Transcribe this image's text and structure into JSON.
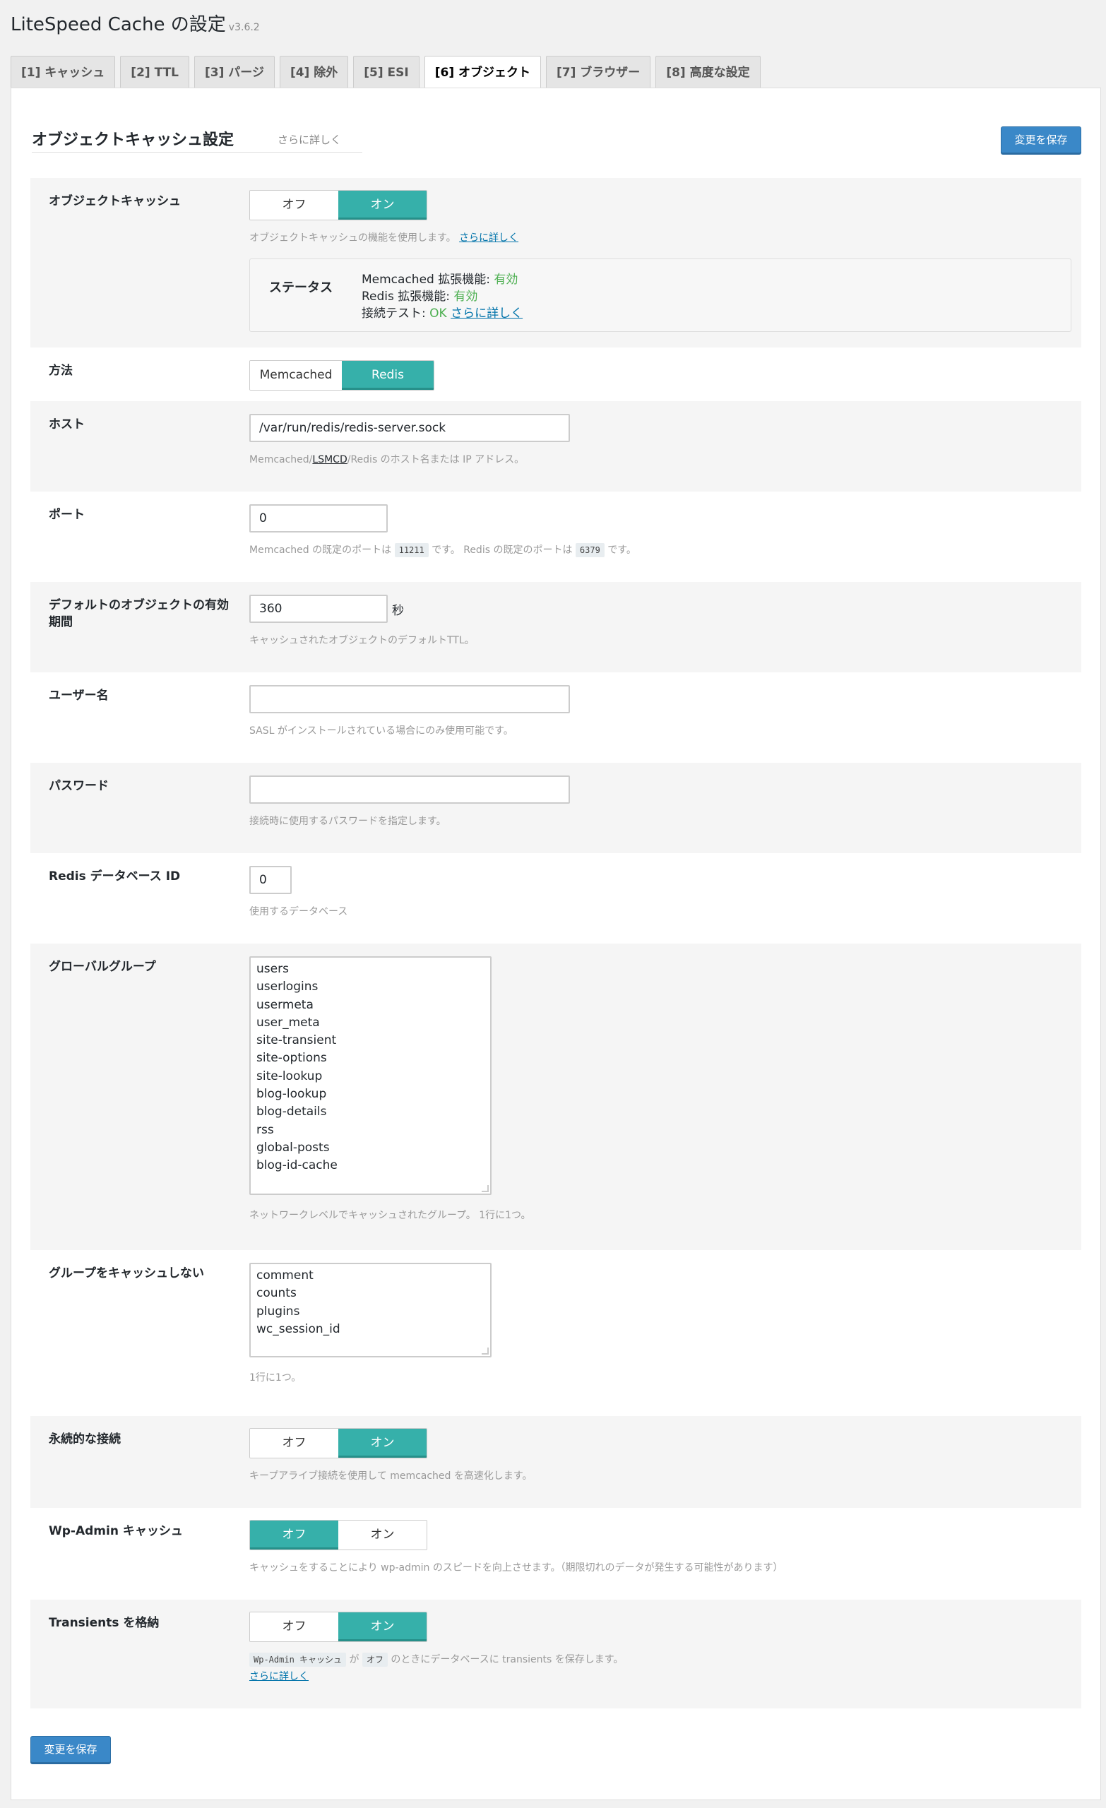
{
  "header": {
    "title": "LiteSpeed Cache の設定",
    "version": "v3.6.2"
  },
  "tabs": [
    "[1] キャッシュ",
    "[2] TTL",
    "[3] パージ",
    "[4] 除外",
    "[5] ESI",
    "[6] オブジェクト",
    "[7] ブラウザー",
    "[8] 高度な設定"
  ],
  "section": {
    "title": "オブジェクトキャッシュ設定",
    "learn_more": "さらに詳しく",
    "save_label": "変更を保存"
  },
  "object_cache": {
    "label": "オブジェクトキャッシュ",
    "off": "オフ",
    "on": "オン",
    "desc": "オブジェクトキャッシュの機能を使用します。",
    "desc_link": "さらに詳しく",
    "status_label": "ステータス",
    "memcached_label": "Memcached 拡張機能: ",
    "memcached_value": "有効",
    "redis_label": "Redis 拡張機能: ",
    "redis_value": "有効",
    "conn_label": "接続テスト: ",
    "conn_value": "OK",
    "conn_link": "さらに詳しく"
  },
  "method": {
    "label": "方法",
    "opt1": "Memcached",
    "opt2": "Redis"
  },
  "host": {
    "label": "ホスト",
    "value": "/var/run/redis/redis-server.sock",
    "desc_pre": "Memcached/",
    "desc_link": "LSMCD",
    "desc_post": "/Redis のホスト名または IP アドレス。"
  },
  "port": {
    "label": "ポート",
    "value": "0",
    "desc1": "Memcached の既定のポートは",
    "code1": "11211",
    "desc2": "です。 Redis の既定のポートは",
    "code2": "6379",
    "desc3": "です。"
  },
  "ttl": {
    "label": "デフォルトのオブジェクトの有効期間",
    "value": "360",
    "unit": "秒",
    "desc": "キャッシュされたオブジェクトのデフォルトTTL。"
  },
  "username": {
    "label": "ユーザー名",
    "value": "",
    "desc": "SASL がインストールされている場合にのみ使用可能です。"
  },
  "password": {
    "label": "パスワード",
    "value": "",
    "desc": "接続時に使用するパスワードを指定します。"
  },
  "redis_db": {
    "label": "Redis データベース ID",
    "value": "0",
    "desc": "使用するデータベース"
  },
  "global_groups": {
    "label": "グローバルグループ",
    "items": [
      "users",
      "userlogins",
      "usermeta",
      "user_meta",
      "site-transient",
      "site-options",
      "site-lookup",
      "blog-lookup",
      "blog-details",
      "rss",
      "global-posts",
      "blog-id-cache"
    ],
    "desc": "ネットワークレベルでキャッシュされたグループ。 1行に1つ。"
  },
  "no_cache_groups": {
    "label": "グループをキャッシュしない",
    "items": [
      "comment",
      "counts",
      "plugins",
      "wc_session_id"
    ],
    "desc": "1行に1つ。"
  },
  "persistent": {
    "label": "永続的な接続",
    "off": "オフ",
    "on": "オン",
    "desc": "キープアライブ接続を使用して memcached を高速化します。"
  },
  "wp_admin": {
    "label": "Wp-Admin キャッシュ",
    "off": "オフ",
    "on": "オン",
    "desc": "キャッシュをすることにより wp-admin のスピードを向上させます。（期限切れのデータが発生する可能性があります）"
  },
  "transients": {
    "label": "Transients を格納",
    "off": "オフ",
    "on": "オン",
    "code1": "Wp-Admin キャッシュ",
    "desc1": "が",
    "code2": "オフ",
    "desc2": "のときにデータベースに transients を保存します。",
    "link": "さらに詳しく"
  }
}
